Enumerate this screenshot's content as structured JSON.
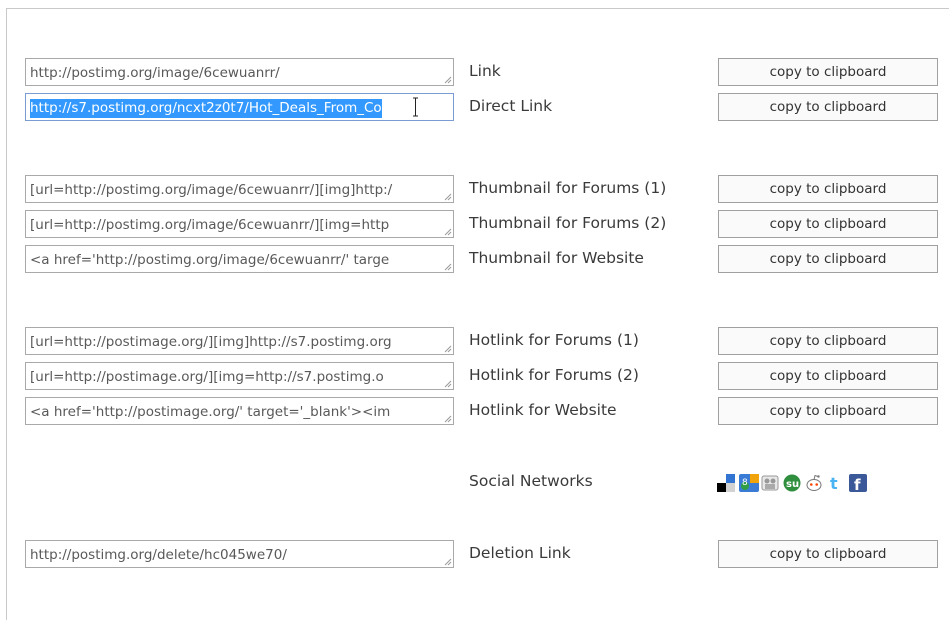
{
  "rows": {
    "link": {
      "value": "http://postimg.org/image/6cewuanrr/",
      "label": "Link",
      "button": "copy to clipboard"
    },
    "direct": {
      "value": "http://s7.postimg.org/ncxt2z0t7/Hot_Deals_From_Co",
      "label": "Direct Link",
      "button": "copy to clipboard"
    },
    "thumb_forums_1": {
      "value": "[url=http://postimg.org/image/6cewuanrr/][img]http:/",
      "label": "Thumbnail for Forums (1)",
      "button": "copy to clipboard"
    },
    "thumb_forums_2": {
      "value": "[url=http://postimg.org/image/6cewuanrr/][img=http",
      "label": "Thumbnail for Forums (2)",
      "button": "copy to clipboard"
    },
    "thumb_website": {
      "value": "<a href='http://postimg.org/image/6cewuanrr/' targe",
      "label": "Thumbnail for Website",
      "button": "copy to clipboard"
    },
    "hot_forums_1": {
      "value": "[url=http://postimage.org/][img]http://s7.postimg.org",
      "label": "Hotlink for Forums (1)",
      "button": "copy to clipboard"
    },
    "hot_forums_2": {
      "value": "[url=http://postimage.org/][img=http://s7.postimg.o",
      "label": "Hotlink for Forums (2)",
      "button": "copy to clipboard"
    },
    "hot_website": {
      "value": "<a href='http://postimage.org/' target='_blank'><im",
      "label": "Hotlink for Website",
      "button": "copy to clipboard"
    },
    "deletion": {
      "value": "http://postimg.org/delete/hc045we70/",
      "label": "Deletion Link",
      "button": "copy to clipboard"
    }
  },
  "social": {
    "label": "Social Networks",
    "icons": [
      "delicious-icon",
      "digg-icon",
      "myspace-icon",
      "stumbleupon-icon",
      "reddit-icon",
      "twitter-icon",
      "facebook-icon"
    ]
  },
  "colors": {
    "selection": "#3399ff",
    "border": "#a9a9a9",
    "text": "#595959"
  }
}
